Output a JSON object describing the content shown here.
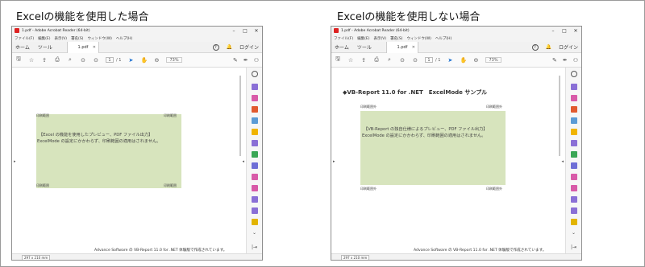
{
  "headings": {
    "left": "Excelの機能を使用した場合",
    "right": "Excelの機能を使用しない場合"
  },
  "window": {
    "title": "1.pdf - Adobe Acrobat Reader (64-bit)",
    "menu": [
      "ファイル(F)",
      "編集(E)",
      "表示(V)",
      "署名(S)",
      "ウィンドウ(W)",
      "ヘルプ(H)"
    ],
    "tabs": {
      "home": "ホーム",
      "tools": "ツール",
      "doc": "1.pdf"
    },
    "login": "ログイン",
    "help_glyph": "?",
    "page_current": "1",
    "page_total": "/ 1",
    "zoom": "73%",
    "status_size": "297 x 210 mm"
  },
  "left_doc": {
    "corner_label": "印刷範囲",
    "line1": "【Excel の機能を使用したプレビュー、PDF ファイル出力】",
    "line2": "ExcelMode の設定にかかわらず、印刷範囲の適用はされません。",
    "footer": "Advance Software の VB-Report 11.0 for .NET 体験版で作成されています。"
  },
  "right_doc": {
    "title": "◆VB-Report 11.0 for .NET　ExcelMode サンプル",
    "corner_label": "印刷範囲外",
    "line1": "【VB-Report の独自仕様によるプレビュー、PDF ファイル出力】",
    "line2": "ExcelMode の設定にかかわらず、印刷範囲の適用はされません。",
    "footer": "Advance Software の VB-Report 11.0 for .NET 体験版で作成されています。"
  },
  "colors": {
    "green_box": "#d7e4bd",
    "acrobat_red": "#dd2222",
    "side_icons": [
      "#8a6fd6",
      "#d85aa8",
      "#e15a2f",
      "#5b9bd5",
      "#f0b400",
      "#8a6fd6",
      "#3aa655",
      "#6f6fd6",
      "#d85aa8",
      "#d85aa8",
      "#8a6fd6",
      "#8a6fd6",
      "#e2b400"
    ]
  }
}
